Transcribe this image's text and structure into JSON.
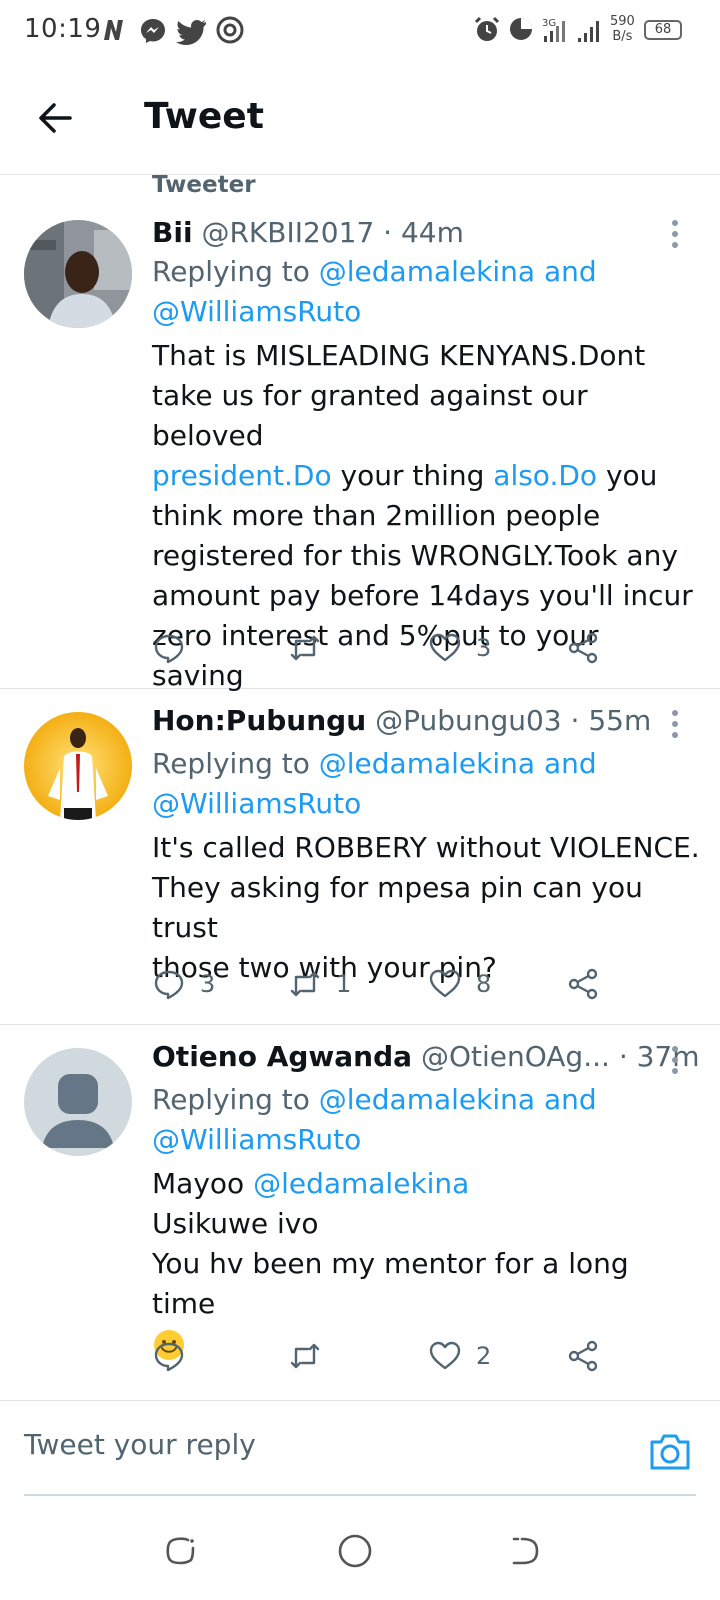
{
  "status_bar": {
    "time": "10:19",
    "net_speed_top": "590",
    "net_speed_bottom": "B/s",
    "battery": "68"
  },
  "header": {
    "title": "Tweet"
  },
  "section_label": "Tweeter",
  "tweets": [
    {
      "name": "Bii",
      "handle": "@RKBII2017",
      "time": "· 44m",
      "replying_prefix": "Replying to",
      "replying_to_1": "@ledamalekina",
      "replying_and": "and",
      "replying_to_2": "@WilliamsRuto",
      "body_lines": [
        "That is MISLEADING KENYANS.Dont",
        "take us for granted against our beloved"
      ],
      "line3_link1": "president.Do",
      "line3_mid": " your thing ",
      "line3_link2": "also.Do",
      "line3_end": " you",
      "body_lines_rest": [
        "think more than 2million people",
        "registered for this WRONGLY.Took any",
        "amount pay before 14days you'll incur",
        "zero interest and 5%put to your saving"
      ],
      "replies": "",
      "retweets": "",
      "likes": "3"
    },
    {
      "name": "Hon:Pubungu",
      "handle": "@Pubungu03",
      "time": "· 55m",
      "replying_prefix": "Replying to",
      "replying_to_1": "@ledamalekina",
      "replying_and": "and",
      "replying_to_2": "@WilliamsRuto",
      "body_lines": [
        "It's called ROBBERY without VIOLENCE.",
        "They asking for mpesa pin can you trust",
        "those two with your pin?"
      ],
      "replies": "3",
      "retweets": "1",
      "likes": "8"
    },
    {
      "name": "Otieno Agwanda",
      "handle": "@OtienOAg...",
      "time": "· 37m",
      "replying_prefix": "Replying to",
      "replying_to_1": "@ledamalekina",
      "replying_and": "and",
      "replying_to_2": "@WilliamsRuto",
      "line1_text": "Mayoo ",
      "line1_link": "@ledamalekina",
      "body_lines": [
        "Usikuwe ivo",
        "You hv been my mentor for a long time"
      ],
      "emoji": "🙂",
      "replies": "",
      "retweets": "",
      "likes": "2"
    }
  ],
  "reply_bar": {
    "placeholder": "Tweet your reply"
  },
  "icons": {
    "back": "arrow-left-icon",
    "more": "more-vertical-icon",
    "reply": "comment-icon",
    "retweet": "retweet-icon",
    "like": "heart-icon",
    "share": "share-icon",
    "camera": "camera-icon"
  },
  "colors": {
    "link": "#1d9bf0",
    "secondary_text": "#536471",
    "primary_text": "#0f1419"
  }
}
